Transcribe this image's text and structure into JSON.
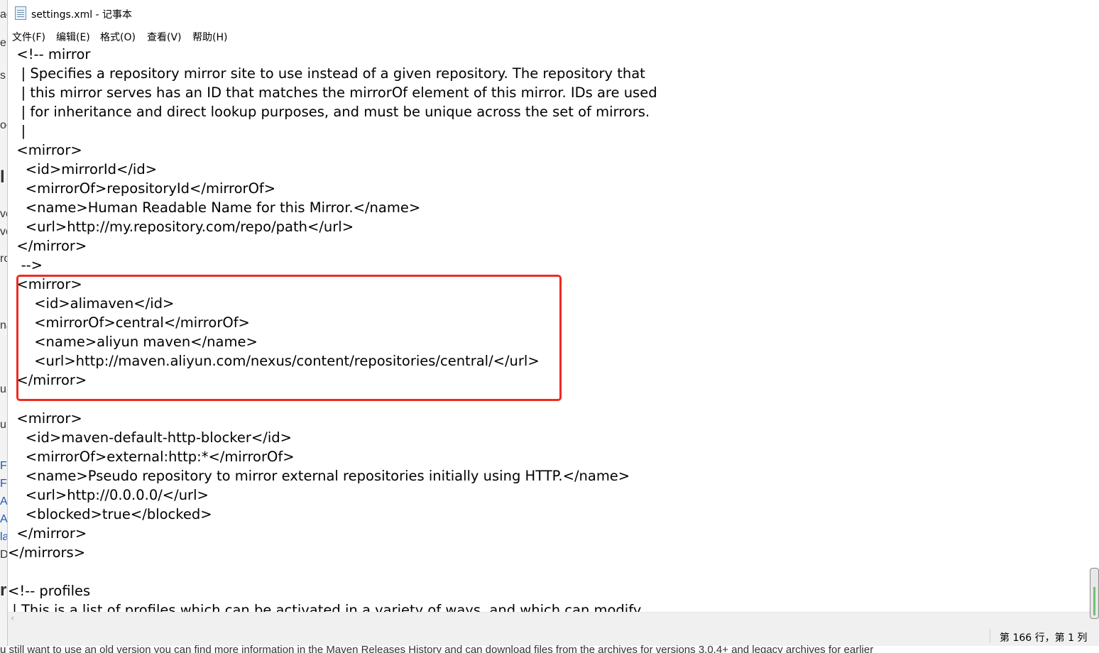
{
  "window": {
    "title": "settings.xml - 记事本"
  },
  "menu": [
    {
      "label": "文件(F)"
    },
    {
      "label": "编辑(E)"
    },
    {
      "label": "格式(O)"
    },
    {
      "label": "查看(V)"
    },
    {
      "label": "帮助(H)"
    }
  ],
  "editor": {
    "lines": [
      "  <!-- mirror",
      "   | Specifies a repository mirror site to use instead of a given repository. The repository that",
      "   | this mirror serves has an ID that matches the mirrorOf element of this mirror. IDs are used",
      "   | for inheritance and direct lookup purposes, and must be unique across the set of mirrors.",
      "   |",
      "  <mirror>",
      "    <id>mirrorId</id>",
      "    <mirrorOf>repositoryId</mirrorOf>",
      "    <name>Human Readable Name for this Mirror.</name>",
      "    <url>http://my.repository.com/repo/path</url>",
      "  </mirror>",
      "   -->",
      "  <mirror>",
      "      <id>alimaven</id>",
      "      <mirrorOf>central</mirrorOf>",
      "      <name>aliyun maven</name>",
      "      <url>http://maven.aliyun.com/nexus/content/repositories/central/</url>",
      "  </mirror>",
      "",
      "  <mirror>",
      "    <id>maven-default-http-blocker</id>",
      "    <mirrorOf>external:http:*</mirrorOf>",
      "    <name>Pseudo repository to mirror external repositories initially using HTTP.</name>",
      "    <url>http://0.0.0.0/</url>",
      "    <blocked>true</blocked>",
      "  </mirror>",
      "</mirrors>",
      "",
      "<!-- profiles",
      " | This is a list of profiles which can be activated in a variety of ways, and which can modify"
    ]
  },
  "status": {
    "position": "第 166 行，第 1 列"
  },
  "background_page": {
    "bottom_text": "u still want to use an old version you can find more information in the Maven Releases History and can download files from the archives for versions 3.0.4+ and legacy archives for earlier",
    "colors": {
      "link": "#1a5fb4"
    }
  },
  "colors": {
    "highlight_border": "#f02a22",
    "text": "#000000",
    "status_bg": "#f0f0f0"
  }
}
